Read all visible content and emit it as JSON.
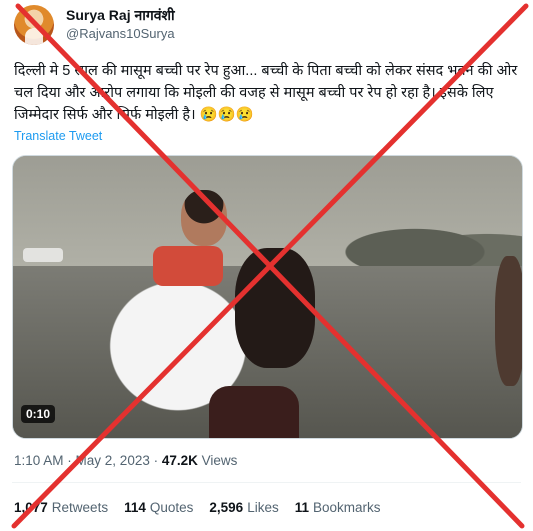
{
  "author": {
    "display_name": "Surya Raj नागवंशी",
    "handle": "@Rajvans10Surya"
  },
  "tweet": {
    "text": "दिल्ली मे 5 साल की मासूम बच्ची पर रेप हुआ... बच्ची के पिता बच्ची को लेकर संसद भवन की ओर चल दिया और आरोप लगाया कि मोइली की वजह से मासूम बच्ची पर रेप हो रहा है। इसके लिए जिम्मेदार सिर्फ और सिर्फ मोइली है। 😢😢😢",
    "translate_label": "Translate Tweet"
  },
  "media": {
    "duration": "0:10"
  },
  "meta": {
    "time": "1:10 AM",
    "date": "May 2, 2023",
    "views_count": "47.2K",
    "views_label": "Views"
  },
  "stats": {
    "retweets_count": "1,077",
    "retweets_label": "Retweets",
    "quotes_count": "114",
    "quotes_label": "Quotes",
    "likes_count": "2,596",
    "likes_label": "Likes",
    "bookmarks_count": "11",
    "bookmarks_label": "Bookmarks"
  },
  "overlay": {
    "cross_color": "#e4312f",
    "icon": "red-x-fact-check-cross"
  }
}
